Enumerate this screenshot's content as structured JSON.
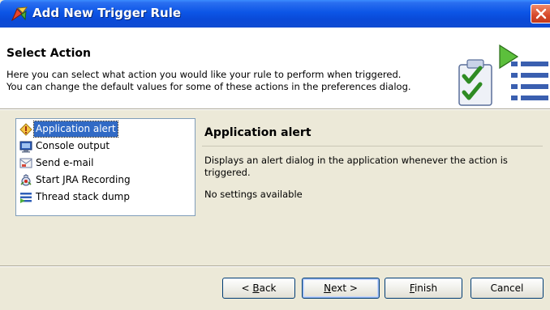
{
  "window": {
    "title": "Add New Trigger Rule",
    "close_icon": "close-icon"
  },
  "header": {
    "title": "Select Action",
    "description_line1": "Here you can select what action you would like your rule to perform when triggered.",
    "description_line2": "You can change the default values for some of these actions in the preferences dialog.",
    "graphic_icon": "checklist-wizard-icon"
  },
  "actions": {
    "selected_index": 0,
    "items": [
      {
        "label": "Application alert",
        "icon": "alert-diamond-icon"
      },
      {
        "label": "Console output",
        "icon": "console-monitor-icon"
      },
      {
        "label": "Send e-mail",
        "icon": "email-icon"
      },
      {
        "label": "Start JRA Recording",
        "icon": "recording-icon"
      },
      {
        "label": "Thread stack dump",
        "icon": "thread-dump-icon"
      }
    ]
  },
  "detail": {
    "title": "Application alert",
    "description": "Displays an alert dialog in the application whenever the action is triggered.",
    "settings": "No settings available"
  },
  "buttons": {
    "back_lt": "< ",
    "back_mnemonic": "B",
    "back_rest": "ack",
    "next_mnemonic": "N",
    "next_rest": "ext >",
    "finish_mnemonic": "F",
    "finish_rest": "inish",
    "cancel": "Cancel"
  },
  "colors": {
    "titlebar": "#0a4ad8",
    "selection": "#316ac5",
    "dialog_bg": "#ece9d8"
  }
}
